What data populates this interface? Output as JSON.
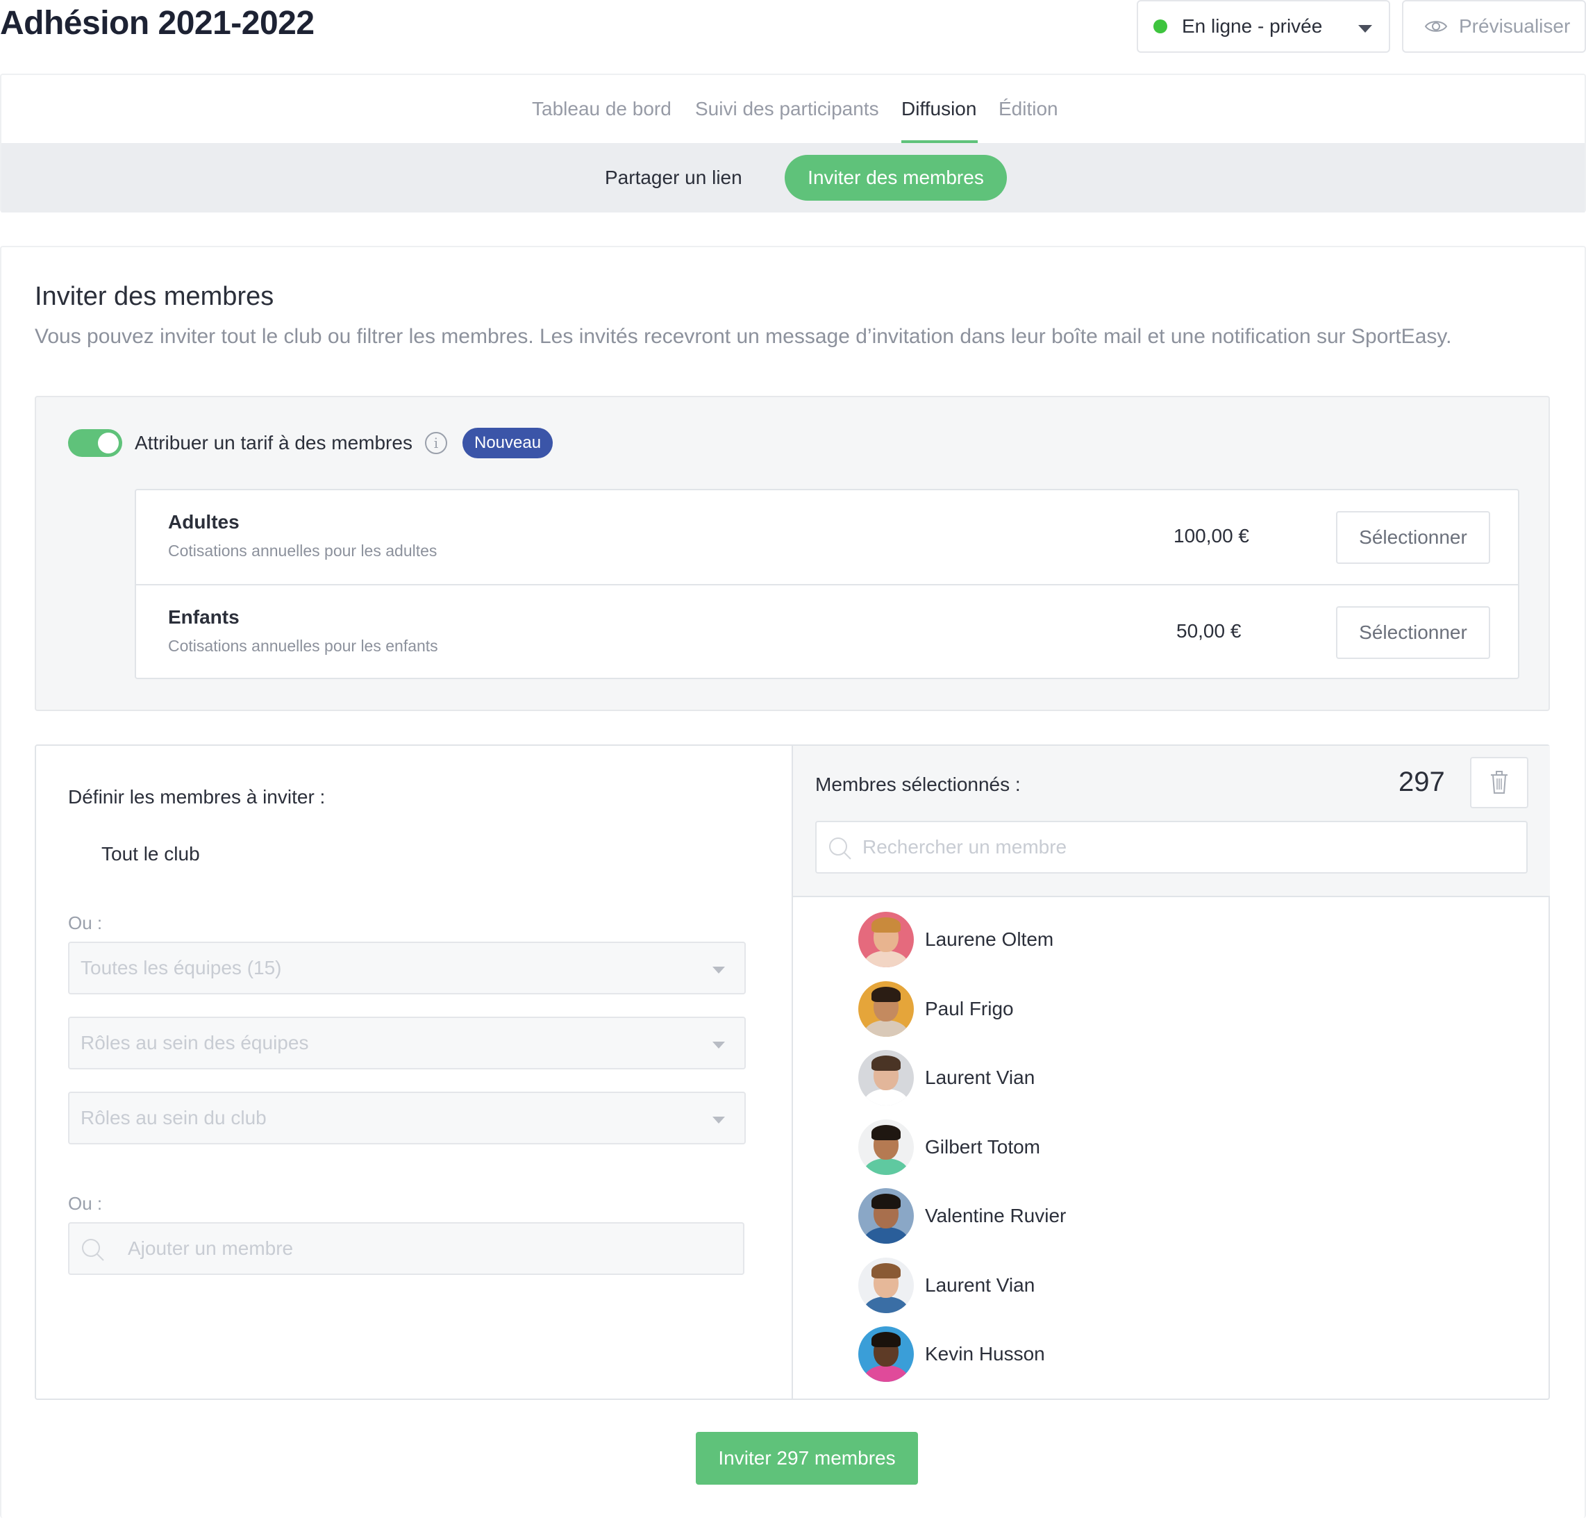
{
  "header": {
    "title": "Adhésion 2021-2022",
    "status_label": "En ligne - privée",
    "status_color": "#3ec43e",
    "preview_label": "Prévisualiser"
  },
  "tabs": [
    {
      "label": "Tableau de bord",
      "active": false
    },
    {
      "label": "Suivi des participants",
      "active": false
    },
    {
      "label": "Diffusion",
      "active": true
    },
    {
      "label": "Édition",
      "active": false
    }
  ],
  "subnav": {
    "share_link": "Partager un lien",
    "invite_members": "Inviter des membres"
  },
  "section": {
    "title": "Inviter des membres",
    "description": "Vous pouvez inviter tout le club ou filtrer les membres. Les invités recevront un message d’invitation dans leur boîte mail et une notification sur SportEasy."
  },
  "tarif": {
    "toggle_on": true,
    "toggle_label": "Attribuer un tarif à des membres",
    "info_icon": "i",
    "badge": "Nouveau",
    "rows": [
      {
        "name": "Adultes",
        "description": "Cotisations annuelles pour les adultes",
        "price": "100,00 €",
        "button": "Sélectionner"
      },
      {
        "name": "Enfants",
        "description": "Cotisations annuelles pour les enfants",
        "price": "50,00 €",
        "button": "Sélectionner"
      }
    ]
  },
  "filters": {
    "define_label": "Définir les membres à inviter :",
    "whole_club": "Tout le club",
    "or_label_1": "Ou :",
    "teams_placeholder": "Toutes les équipes (15)",
    "team_roles_placeholder": "Rôles au sein des équipes",
    "club_roles_placeholder": "Rôles au sein du club",
    "or_label_2": "Ou :",
    "add_member_placeholder": "Ajouter un membre"
  },
  "selected": {
    "label": "Membres sélectionnés :",
    "count": "297",
    "search_placeholder": "Rechercher un membre",
    "members": [
      {
        "name": "Laurene Oltem",
        "skin": "#e8b48f",
        "hair": "#c98a3c",
        "bg": "#e56a7d",
        "shirt": "#f2d5c4"
      },
      {
        "name": "Paul Frigo",
        "skin": "#c48a5f",
        "hair": "#2b1d14",
        "bg": "#e5a53a",
        "shirt": "#d9c9b8"
      },
      {
        "name": "Laurent Vian",
        "skin": "#e2b69a",
        "hair": "#4a3425",
        "bg": "#d6d8dc",
        "shirt": "#ffffff"
      },
      {
        "name": "Gilbert Totom",
        "skin": "#b57a52",
        "hair": "#1f1711",
        "bg": "#f0f1f2",
        "shirt": "#5fc9a0"
      },
      {
        "name": "Valentine Ruvier",
        "skin": "#a86f4d",
        "hair": "#1a1410",
        "bg": "#8aa7c6",
        "shirt": "#2a5e9a"
      },
      {
        "name": "Laurent Vian",
        "skin": "#e6b899",
        "hair": "#8a5a34",
        "bg": "#eef0f3",
        "shirt": "#3a6ea5"
      },
      {
        "name": "Kevin Husson",
        "skin": "#5e3b26",
        "hair": "#1a120c",
        "bg": "#3a9ed8",
        "shirt": "#e04a9a"
      }
    ]
  },
  "invite_button": "Inviter 297 membres",
  "colors": {
    "accent_green": "#5fc27a",
    "badge_blue": "#3b55a8"
  }
}
